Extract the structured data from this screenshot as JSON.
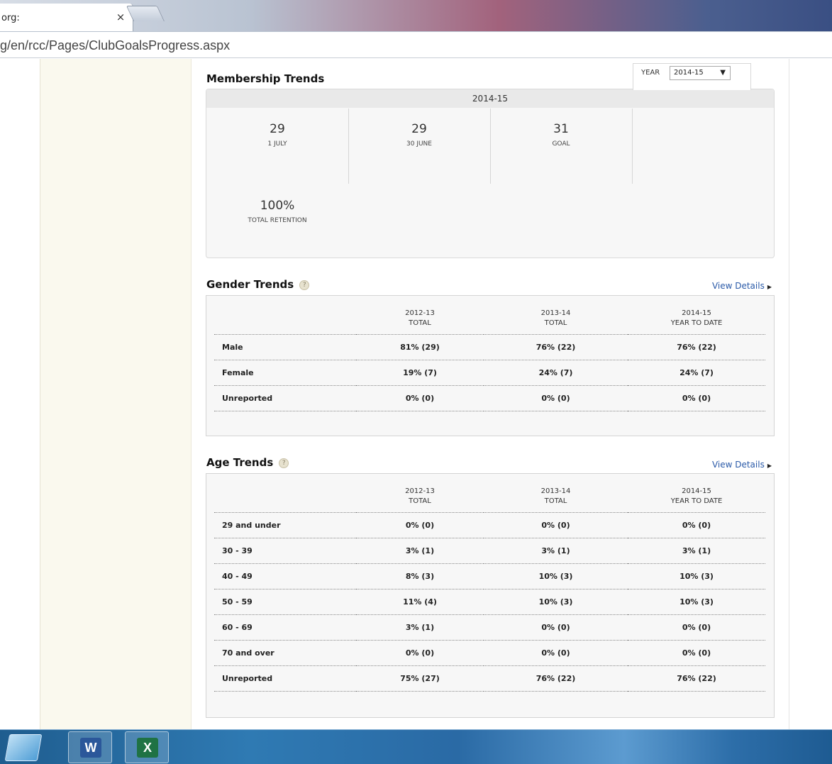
{
  "browser": {
    "tab_title": "org:",
    "tab_close": "×",
    "url": "g/en/rcc/Pages/ClubGoalsProgress.aspx"
  },
  "membership": {
    "title": "Membership Trends",
    "year_label": "YEAR",
    "year_selected": "2014-15",
    "period": "2014-15",
    "stats": [
      {
        "value": "29",
        "label": "1 JULY"
      },
      {
        "value": "29",
        "label": "30 JUNE"
      },
      {
        "value": "31",
        "label": "GOAL"
      }
    ],
    "retention": {
      "value": "100%",
      "label": "TOTAL RETENTION"
    }
  },
  "gender": {
    "title": "Gender Trends",
    "help": "?",
    "view_details": "View Details",
    "columns": [
      {
        "year": "2012-13",
        "sub": "TOTAL"
      },
      {
        "year": "2013-14",
        "sub": "TOTAL"
      },
      {
        "year": "2014-15",
        "sub": "YEAR TO DATE"
      }
    ],
    "rows": [
      {
        "label": "Male",
        "values": [
          "81% (29)",
          "76% (22)",
          "76% (22)"
        ]
      },
      {
        "label": "Female",
        "values": [
          "19% (7)",
          "24% (7)",
          "24% (7)"
        ]
      },
      {
        "label": "Unreported",
        "values": [
          "0% (0)",
          "0% (0)",
          "0% (0)"
        ]
      }
    ]
  },
  "age": {
    "title": "Age Trends",
    "help": "?",
    "view_details": "View Details",
    "columns": [
      {
        "year": "2012-13",
        "sub": "TOTAL"
      },
      {
        "year": "2013-14",
        "sub": "TOTAL"
      },
      {
        "year": "2014-15",
        "sub": "YEAR TO DATE"
      }
    ],
    "rows": [
      {
        "label": "29 and under",
        "values": [
          "0% (0)",
          "0% (0)",
          "0% (0)"
        ]
      },
      {
        "label": "30 - 39",
        "values": [
          "3% (1)",
          "3% (1)",
          "3% (1)"
        ]
      },
      {
        "label": "40 - 49",
        "values": [
          "8% (3)",
          "10% (3)",
          "10% (3)"
        ]
      },
      {
        "label": "50 - 59",
        "values": [
          "11% (4)",
          "10% (3)",
          "10% (3)"
        ]
      },
      {
        "label": "60 - 69",
        "values": [
          "3% (1)",
          "0% (0)",
          "0% (0)"
        ]
      },
      {
        "label": "70 and over",
        "values": [
          "0% (0)",
          "0% (0)",
          "0% (0)"
        ]
      },
      {
        "label": "Unreported",
        "values": [
          "75% (27)",
          "76% (22)",
          "76% (22)"
        ]
      }
    ]
  },
  "taskbar": {
    "apps": [
      {
        "name": "word",
        "letter": "W",
        "color": "#2b579a"
      },
      {
        "name": "excel",
        "letter": "X",
        "color": "#1f7244"
      }
    ]
  }
}
